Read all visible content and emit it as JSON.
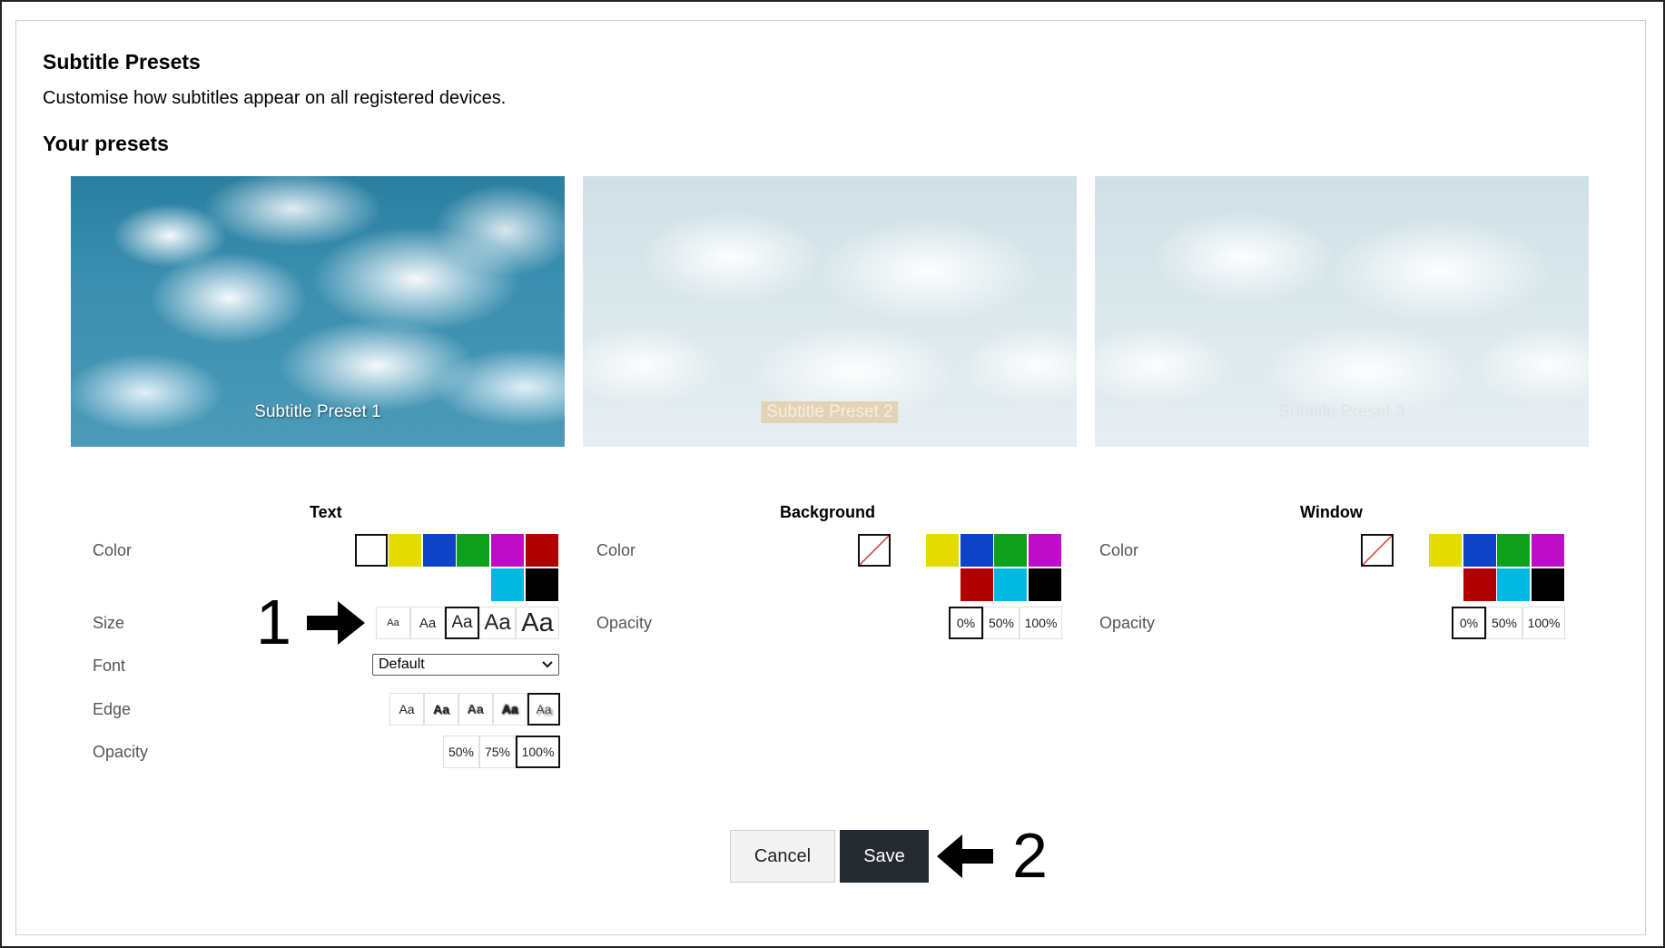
{
  "header": {
    "title": "Subtitle Presets",
    "description": "Customise how subtitles appear on all registered devices.",
    "presets_heading": "Your presets"
  },
  "presets": [
    {
      "caption": "Subtitle Preset 1"
    },
    {
      "caption": "Subtitle Preset 2"
    },
    {
      "caption": "Subtitle Preset 3"
    }
  ],
  "text_section": {
    "heading": "Text",
    "color_label": "Color",
    "size_label": "Size",
    "font_label": "Font",
    "edge_label": "Edge",
    "opacity_label": "Opacity",
    "colors": [
      "#ffffff",
      "#e2dc00",
      "#0c43c8",
      "#0e9f1c",
      "#be0cc8",
      "#b00000",
      "#00b8e0",
      "#000000"
    ],
    "selected_color": "#ffffff",
    "sizes": [
      "Aa",
      "Aa",
      "Aa",
      "Aa",
      "Aa"
    ],
    "selected_size_index": 2,
    "font_value": "Default",
    "edges": [
      "Aa",
      "Aa",
      "Aa",
      "Aa",
      "Aa"
    ],
    "selected_edge_index": 4,
    "opacity_options": [
      "50%",
      "75%",
      "100%"
    ],
    "selected_opacity": "100%"
  },
  "background_section": {
    "heading": "Background",
    "color_label": "Color",
    "opacity_label": "Opacity",
    "colors": [
      "none",
      "#ffffff",
      "#e2dc00",
      "#0c43c8",
      "#0e9f1c",
      "#be0cc8",
      "#b00000",
      "#00b8e0",
      "#000000"
    ],
    "selected_color": "none",
    "opacity_options": [
      "0%",
      "50%",
      "100%"
    ],
    "selected_opacity": "0%"
  },
  "window_section": {
    "heading": "Window",
    "color_label": "Color",
    "opacity_label": "Opacity",
    "colors": [
      "none",
      "#ffffff",
      "#e2dc00",
      "#0c43c8",
      "#0e9f1c",
      "#be0cc8",
      "#b00000",
      "#00b8e0",
      "#000000"
    ],
    "selected_color": "none",
    "opacity_options": [
      "0%",
      "50%",
      "100%"
    ],
    "selected_opacity": "0%"
  },
  "actions": {
    "cancel_label": "Cancel",
    "save_label": "Save"
  },
  "annotations": {
    "marker_1": "1",
    "marker_2": "2"
  }
}
